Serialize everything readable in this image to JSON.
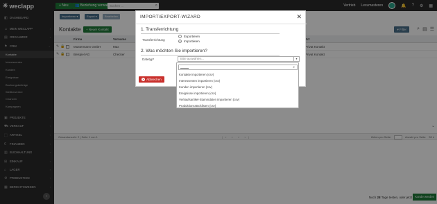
{
  "topbar": {
    "logo": "weclapp",
    "new_label": "Neu",
    "relation_label": "Beziehung verwalten",
    "search_placeholder": "Suchen ...",
    "right_items": [
      "Vertrieb",
      "Lexumasteren"
    ]
  },
  "sidebar": {
    "items": [
      {
        "label": "DASHBOARD",
        "icon": "dashboard-icon"
      },
      {
        "label": "MEIN WECLAPP",
        "icon": "user-icon"
      },
      {
        "label": "ORGANIZER",
        "icon": "calendar-icon"
      },
      {
        "label": "CRM",
        "icon": "crm-icon"
      }
    ],
    "sub_items": [
      "Kontakte",
      "Interessenten",
      "Kunden",
      "Ereignisse",
      "Buchungsbeiträge",
      "Wettbewerber",
      "Chancen",
      "Kampagnen"
    ],
    "groups": [
      "PROJEKTE",
      "VERKAUF",
      "ARTIKEL",
      "FINANZEN",
      "BUCHHALTUNG",
      "EINKAUF",
      "LAGER",
      "PRODUKTION",
      "BERICHTSWESEN"
    ]
  },
  "main": {
    "toolbar": [
      "Importieren",
      "Export",
      "Bearbeiten"
    ],
    "title": "Kontakte",
    "new_contact": "Neuer Kontakt",
    "filter": "Filter",
    "columns": [
      "Firma",
      "Vorname",
      "Art"
    ],
    "rows": [
      {
        "firma": "Mustermann GmbH",
        "vorname": "Max",
        "art": "Privat Kontakt"
      },
      {
        "firma": "Beispiel AG",
        "vorname": "Checker",
        "art": "Privat Kontakt"
      }
    ],
    "pager_text": "Gesamtanzahl: 2 | Seite 1 von 1",
    "pager_nav": "|< < > >|",
    "per_page_label": "Zeilen pro Seite:",
    "display_label": "Anzahl pro Seite:",
    "trial_prefix": "Noch",
    "trial_days": "28",
    "trial_suffix": "Tage testen, oder jetzt",
    "become_customer": "Kunde werden"
  },
  "dialog": {
    "title": "IMPORT/EXPORT-WIZARD",
    "section1": "1. Transferrichtung",
    "transfer_label": "Transferrichtung",
    "opt_export": "Exportieren",
    "opt_import": "Importieren",
    "section2": "2. Was möchten Sie importieren?",
    "datatype_label": "Datetyp*",
    "select_placeholder": "Bitte auswählen...",
    "cancel": "Abbrechen",
    "options": [
      "Kontakte importieren (csv)",
      "Interessenten importieren (csv)",
      "Kunden importieren (csv)",
      "Ereignisse importieren (csv)",
      "Verkaufsartikel-Stammdaten importieren (csv)",
      "Produktionsstücklisten (csv)"
    ]
  }
}
